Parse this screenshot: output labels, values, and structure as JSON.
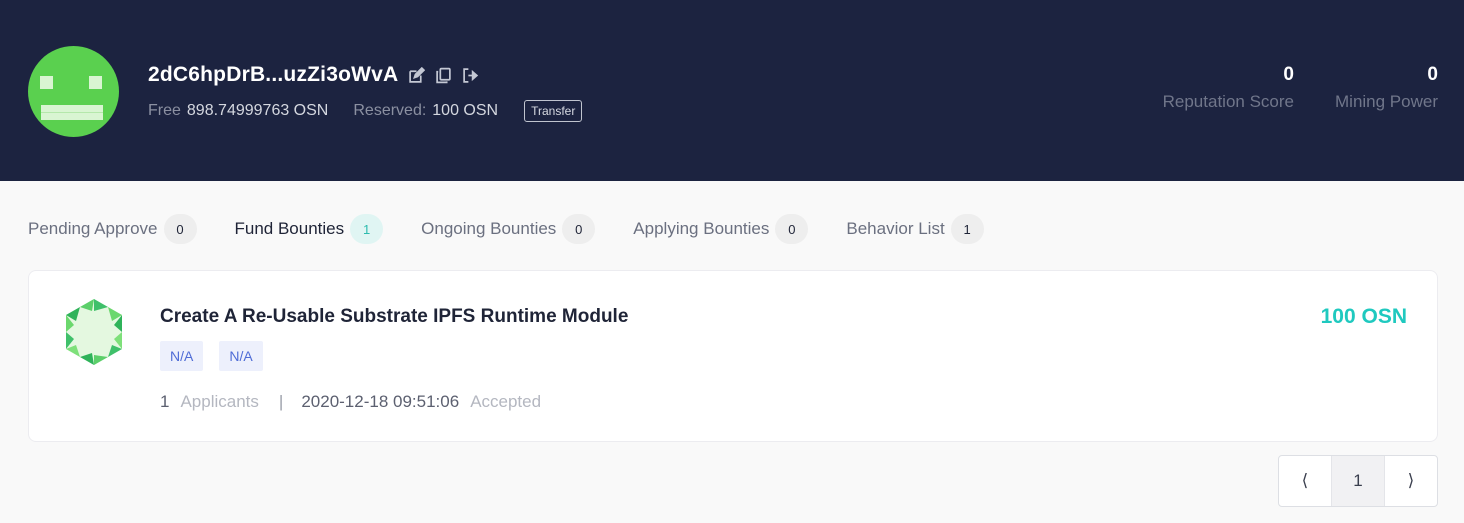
{
  "header": {
    "address": "2dC6hpDrB...uzZi3oWvA",
    "icons": [
      "edit-icon",
      "copy-icon",
      "logout-icon"
    ],
    "free_label": "Free",
    "free_value": "898.74999763 OSN",
    "reserved_label": "Reserved:",
    "reserved_value": "100 OSN",
    "transfer_label": "Transfer",
    "reputation_value": "0",
    "reputation_label": "Reputation Score",
    "mining_value": "0",
    "mining_label": "Mining Power"
  },
  "tabs": [
    {
      "label": "Pending Approve",
      "count": "0"
    },
    {
      "label": "Fund Bounties",
      "count": "1"
    },
    {
      "label": "Ongoing Bounties",
      "count": "0"
    },
    {
      "label": "Applying Bounties",
      "count": "0"
    },
    {
      "label": "Behavior List",
      "count": "1"
    }
  ],
  "active_tab": "Fund Bounties",
  "bounty": {
    "title": "Create A Re-Usable Substrate IPFS Runtime Module",
    "tags": [
      "N/A",
      "N/A"
    ],
    "applicants_count": "1",
    "applicants_label": "Applicants",
    "separator": "|",
    "date": "2020-12-18 09:51:06",
    "status": "Accepted",
    "amount": "100 OSN"
  },
  "pagination": {
    "prev": "⟨",
    "current": "1",
    "next": "⟩"
  },
  "colors": {
    "header_bg": "#1c2340",
    "accent": "#1fc9bf",
    "avatar_green": "#5ad04f",
    "tag_blue": "#4f6cd6"
  }
}
